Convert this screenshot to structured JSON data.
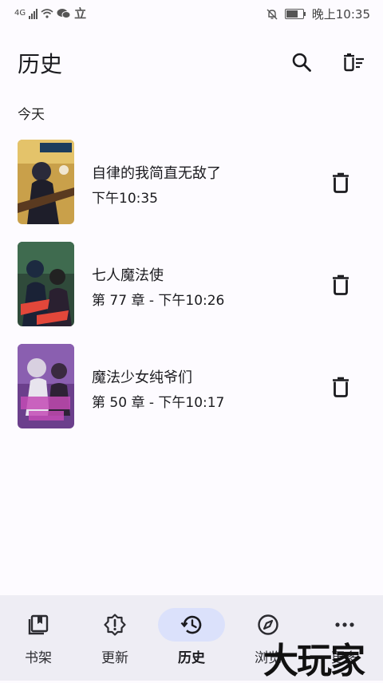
{
  "status_bar": {
    "network": "4G",
    "carrier_icon": "立",
    "time": "晚上10:35"
  },
  "header": {
    "title": "历史",
    "search_icon": "search-icon",
    "clear_icon": "delete-sweep-icon"
  },
  "section": {
    "label": "今天"
  },
  "history": [
    {
      "title": "自律的我简直无敌了",
      "meta": "下午10:35",
      "cover_color": "#c9a04a"
    },
    {
      "title": "七人魔法使",
      "meta": "第 77 章 - 下午10:26",
      "cover_color": "#2f4a3a"
    },
    {
      "title": "魔法少女纯爷们",
      "meta": "第 50 章 - 下午10:17",
      "cover_color": "#6b3f8c"
    }
  ],
  "bottom_nav": [
    {
      "label": "书架",
      "icon": "bookshelf-icon"
    },
    {
      "label": "更新",
      "icon": "updates-alert-icon"
    },
    {
      "label": "历史",
      "icon": "history-icon",
      "active": true
    },
    {
      "label": "浏览",
      "icon": "compass-icon"
    },
    {
      "label": "更多",
      "icon": "more-dots-icon"
    }
  ],
  "watermark": "大玩家",
  "colors": {
    "background": "#fdfbff",
    "nav_background": "#eeedf4",
    "active_pill": "#dbe1fb",
    "text": "#1b1b1f"
  }
}
